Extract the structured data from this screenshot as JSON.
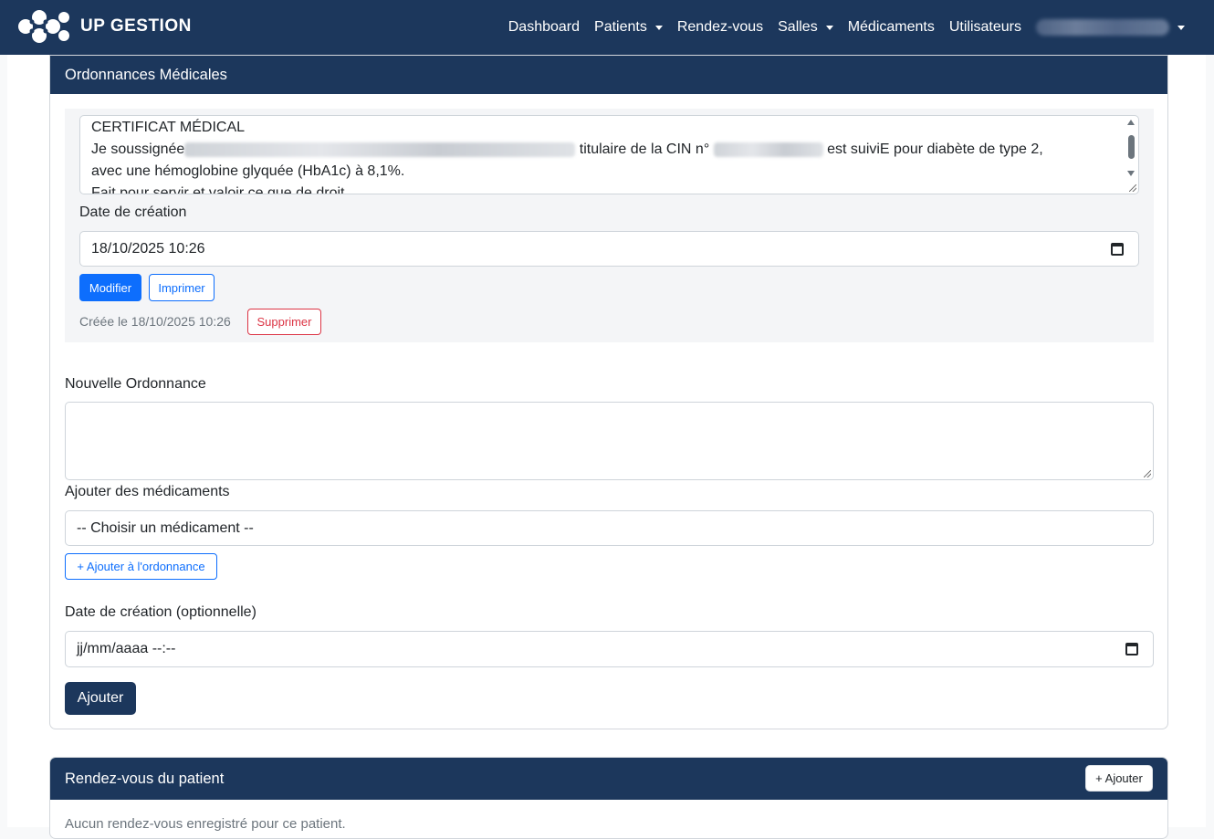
{
  "navbar": {
    "brand": "UP GESTION",
    "links": [
      {
        "label": "Dashboard",
        "dropdown": false
      },
      {
        "label": "Patients",
        "dropdown": true
      },
      {
        "label": "Rendez-vous",
        "dropdown": false
      },
      {
        "label": "Salles",
        "dropdown": true
      },
      {
        "label": "Médicaments",
        "dropdown": false
      },
      {
        "label": "Utilisateurs",
        "dropdown": false
      }
    ],
    "user_menu_redacted": true
  },
  "ordonnances": {
    "header": "Ordonnances Médicales",
    "existing": {
      "line1": "CERTIFICAT MÉDICAL",
      "line2_prefix": "Je soussignée",
      "line2_mid": "titulaire de la CIN n°",
      "line2_suffix": "est suiviE pour diabète de type 2,",
      "line3": "avec une hémoglobine glyquée (HbA1c) à 8,1%.",
      "line4": "Fait pour servir et valoir ce que de droit.",
      "date_label": "Date de création",
      "date_value": "18/10/2025 10:26",
      "modify_button": "Modifier",
      "print_button": "Imprimer",
      "created_text": "Créée le 18/10/2025 10:26",
      "delete_button": "Supprimer"
    },
    "new": {
      "title": "Nouvelle Ordonnance",
      "textarea_value": "",
      "meds_label": "Ajouter des médicaments",
      "meds_select": "-- Choisir un médicament --",
      "add_to_button": "+ Ajouter à l'ordonnance",
      "date_label": "Date de création (optionnelle)",
      "date_placeholder": "jj/mm/aaaa --:--",
      "submit_button": "Ajouter"
    }
  },
  "rendezvous": {
    "header": "Rendez-vous du patient",
    "add_button": "+ Ajouter",
    "empty_text": "Aucun rendez-vous enregistré pour ce patient."
  },
  "colors": {
    "navy": "#1c375c",
    "primary": "#0d6efd",
    "danger": "#dc3545"
  }
}
